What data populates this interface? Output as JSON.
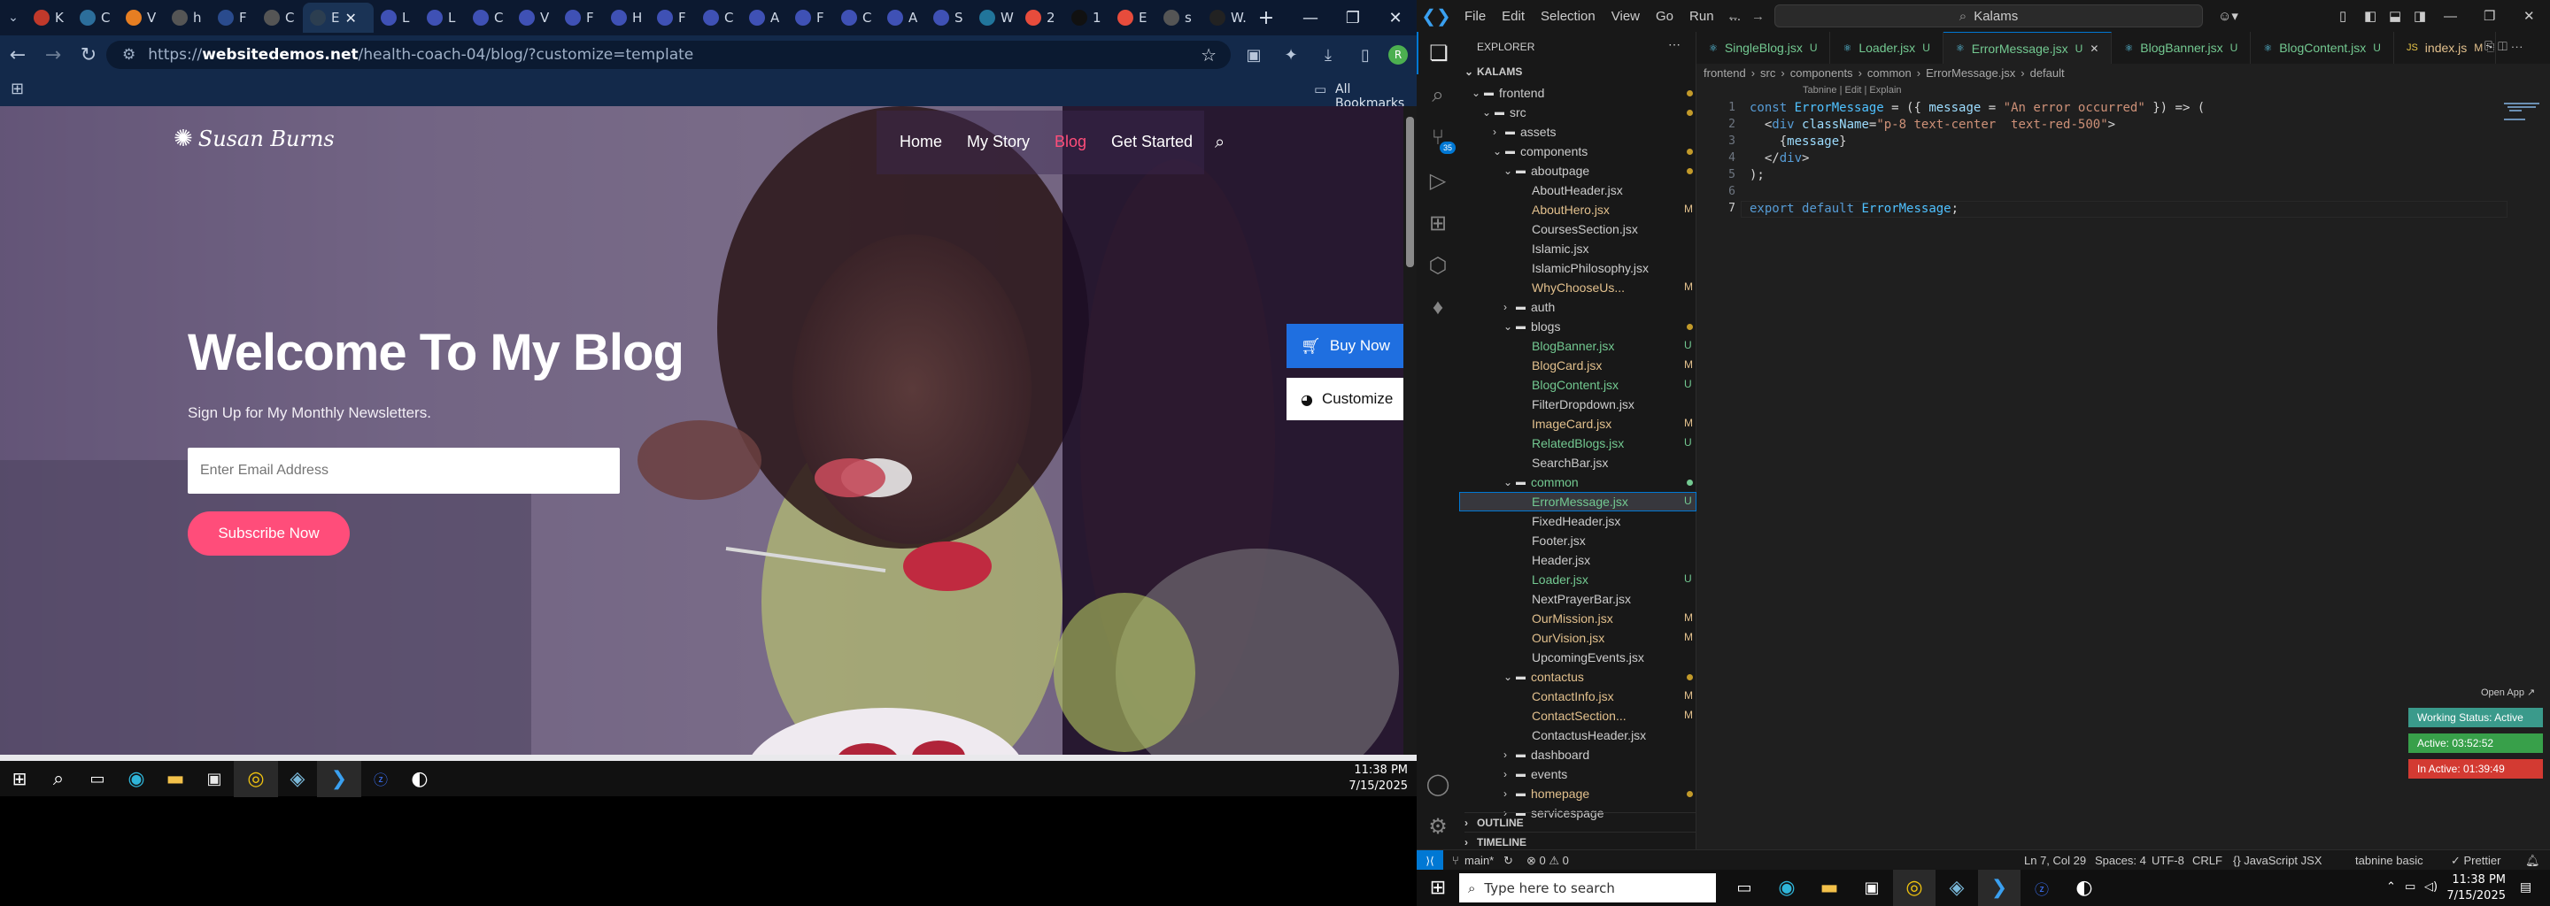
{
  "chrome": {
    "tabs": [
      {
        "label": "K",
        "color": "#c0392b"
      },
      {
        "label": "C",
        "color": "#2c6e9b"
      },
      {
        "label": "V",
        "color": "#e67e22"
      },
      {
        "label": "h",
        "color": "#555"
      },
      {
        "label": "F",
        "color": "#2a4b8d"
      },
      {
        "label": "C",
        "color": "#555"
      },
      {
        "label": "E",
        "color": "#2c3e50"
      },
      {
        "label": "L",
        "color": "#3f51b5"
      },
      {
        "label": "L",
        "color": "#3f51b5"
      },
      {
        "label": "C",
        "color": "#3f51b5"
      },
      {
        "label": "V",
        "color": "#3f51b5"
      },
      {
        "label": "F",
        "color": "#3f51b5"
      },
      {
        "label": "H",
        "color": "#3f51b5"
      },
      {
        "label": "F",
        "color": "#3f51b5"
      },
      {
        "label": "C",
        "color": "#3f51b5"
      },
      {
        "label": "A",
        "color": "#3f51b5"
      },
      {
        "label": "F",
        "color": "#3f51b5"
      },
      {
        "label": "C",
        "color": "#3f51b5"
      },
      {
        "label": "A",
        "color": "#3f51b5"
      },
      {
        "label": "S",
        "color": "#3f51b5"
      },
      {
        "label": "W",
        "color": "#21759b"
      },
      {
        "label": "2",
        "color": "#e74c3c"
      },
      {
        "label": "1",
        "color": "#111"
      },
      {
        "label": "E",
        "color": "#e74c3c"
      },
      {
        "label": "s",
        "color": "#555"
      },
      {
        "label": "W.",
        "color": "#222"
      }
    ],
    "new_tab": "+",
    "window_controls": {
      "minimize": "—",
      "restore": "❐",
      "close": "✕"
    },
    "url": {
      "scheme": "https://",
      "host": "websitedemos.net",
      "path": "/health-coach-04/blog/?customize=template"
    },
    "bookmarks_label": "All Bookmarks",
    "profile_initial": "R"
  },
  "site": {
    "logo": "Susan Burns",
    "nav": [
      "Home",
      "My Story",
      "Blog",
      "Get Started"
    ],
    "hero_title": "Welcome To My Blog",
    "hero_subtitle": "Sign Up for My Monthly Newsletters.",
    "email_placeholder": "Enter Email Address",
    "subscribe_label": "Subscribe Now",
    "buy_now_label": "Buy Now",
    "customize_label": "Customize",
    "accent": "#ff4d7a"
  },
  "left_taskbar": {
    "time": "11:38 PM",
    "date": "7/15/2025"
  },
  "vscode": {
    "menu": [
      "File",
      "Edit",
      "Selection",
      "View",
      "Go",
      "Run",
      "..."
    ],
    "search": "Kalams",
    "explorer_title": "EXPLORER",
    "workspace": "KALAMS",
    "tree": [
      {
        "label": "frontend",
        "depth": 0,
        "folder": true,
        "open": true,
        "color": "#cccccc",
        "dot": "#c29a2a"
      },
      {
        "label": "src",
        "depth": 1,
        "folder": true,
        "open": true,
        "color": "#cccccc",
        "dot": "#c29a2a"
      },
      {
        "label": "assets",
        "depth": 2,
        "folder": true,
        "open": false,
        "color": "#cccccc",
        "dot": ""
      },
      {
        "label": "components",
        "depth": 2,
        "folder": true,
        "open": true,
        "color": "#cccccc",
        "dot": "#c29a2a"
      },
      {
        "label": "aboutpage",
        "depth": 3,
        "folder": true,
        "open": true,
        "color": "#cccccc",
        "dot": "#c29a2a"
      },
      {
        "label": "AboutHeader.jsx",
        "depth": 4,
        "folder": false,
        "color": "#cccccc",
        "badge": ""
      },
      {
        "label": "AboutHero.jsx",
        "depth": 4,
        "folder": false,
        "color": "#e2c08d",
        "badge": "M"
      },
      {
        "label": "CoursesSection.jsx",
        "depth": 4,
        "folder": false,
        "color": "#cccccc",
        "badge": ""
      },
      {
        "label": "Islamic.jsx",
        "depth": 4,
        "folder": false,
        "color": "#cccccc",
        "badge": ""
      },
      {
        "label": "IslamicPhilosophy.jsx",
        "depth": 4,
        "folder": false,
        "color": "#cccccc",
        "badge": ""
      },
      {
        "label": "WhyChooseUs...",
        "depth": 4,
        "folder": false,
        "color": "#e2c08d",
        "badge": "M"
      },
      {
        "label": "auth",
        "depth": 3,
        "folder": true,
        "open": false,
        "color": "#cccccc",
        "dot": ""
      },
      {
        "label": "blogs",
        "depth": 3,
        "folder": true,
        "open": true,
        "color": "#cccccc",
        "dot": "#c29a2a"
      },
      {
        "label": "BlogBanner.jsx",
        "depth": 4,
        "folder": false,
        "color": "#73c991",
        "badge": "U"
      },
      {
        "label": "BlogCard.jsx",
        "depth": 4,
        "folder": false,
        "color": "#e2c08d",
        "badge": "M"
      },
      {
        "label": "BlogContent.jsx",
        "depth": 4,
        "folder": false,
        "color": "#73c991",
        "badge": "U"
      },
      {
        "label": "FilterDropdown.jsx",
        "depth": 4,
        "folder": false,
        "color": "#cccccc",
        "badge": ""
      },
      {
        "label": "ImageCard.jsx",
        "depth": 4,
        "folder": false,
        "color": "#e2c08d",
        "badge": "M"
      },
      {
        "label": "RelatedBlogs.jsx",
        "depth": 4,
        "folder": false,
        "color": "#73c991",
        "badge": "U"
      },
      {
        "label": "SearchBar.jsx",
        "depth": 4,
        "folder": false,
        "color": "#cccccc",
        "badge": ""
      },
      {
        "label": "common",
        "depth": 3,
        "folder": true,
        "open": true,
        "color": "#73c991",
        "dot": "#73c991"
      },
      {
        "label": "ErrorMessage.jsx",
        "depth": 4,
        "folder": false,
        "color": "#73c991",
        "badge": "U",
        "selected": true
      },
      {
        "label": "FixedHeader.jsx",
        "depth": 4,
        "folder": false,
        "color": "#cccccc",
        "badge": ""
      },
      {
        "label": "Footer.jsx",
        "depth": 4,
        "folder": false,
        "color": "#cccccc",
        "badge": ""
      },
      {
        "label": "Header.jsx",
        "depth": 4,
        "folder": false,
        "color": "#cccccc",
        "badge": ""
      },
      {
        "label": "Loader.jsx",
        "depth": 4,
        "folder": false,
        "color": "#73c991",
        "badge": "U"
      },
      {
        "label": "NextPrayerBar.jsx",
        "depth": 4,
        "folder": false,
        "color": "#cccccc",
        "badge": ""
      },
      {
        "label": "OurMission.jsx",
        "depth": 4,
        "folder": false,
        "color": "#e2c08d",
        "badge": "M"
      },
      {
        "label": "OurVision.jsx",
        "depth": 4,
        "folder": false,
        "color": "#e2c08d",
        "badge": "M"
      },
      {
        "label": "UpcomingEvents.jsx",
        "depth": 4,
        "folder": false,
        "color": "#cccccc",
        "badge": ""
      },
      {
        "label": "contactus",
        "depth": 3,
        "folder": true,
        "open": true,
        "color": "#e2c08d",
        "dot": "#c29a2a"
      },
      {
        "label": "ContactInfo.jsx",
        "depth": 4,
        "folder": false,
        "color": "#e2c08d",
        "badge": "M"
      },
      {
        "label": "ContactSection...",
        "depth": 4,
        "folder": false,
        "color": "#e2c08d",
        "badge": "M"
      },
      {
        "label": "ContactusHeader.jsx",
        "depth": 4,
        "folder": false,
        "color": "#cccccc",
        "badge": ""
      },
      {
        "label": "dashboard",
        "depth": 3,
        "folder": true,
        "open": false,
        "color": "#cccccc",
        "dot": ""
      },
      {
        "label": "events",
        "depth": 3,
        "folder": true,
        "open": false,
        "color": "#cccccc",
        "dot": ""
      },
      {
        "label": "homepage",
        "depth": 3,
        "folder": true,
        "open": false,
        "color": "#e2c08d",
        "dot": "#c29a2a"
      },
      {
        "label": "servicespage",
        "depth": 3,
        "folder": true,
        "open": false,
        "color": "#cccccc",
        "dot": ""
      }
    ],
    "outline_label": "OUTLINE",
    "timeline_label": "TIMELINE",
    "editor_tabs": [
      {
        "name": "SingleBlog.jsx",
        "status": "U",
        "active": false
      },
      {
        "name": "Loader.jsx",
        "status": "U",
        "active": false
      },
      {
        "name": "ErrorMessage.jsx",
        "status": "U",
        "active": true
      },
      {
        "name": "BlogBanner.jsx",
        "status": "U",
        "active": false
      },
      {
        "name": "BlogContent.jsx",
        "status": "U",
        "active": false
      },
      {
        "name": "index.js",
        "status": "M",
        "active": false
      }
    ],
    "breadcrumb": [
      "frontend",
      "src",
      "components",
      "common",
      "ErrorMessage.jsx",
      "default"
    ],
    "codelens": "Tabnine | Edit | Explain",
    "code_lines": [
      "const ErrorMessage = ({ message = \"An error occurred\" }) => (",
      "  <div className=\"p-8 text-center  text-red-500\">",
      "    {message}",
      "  </div>",
      ");",
      "",
      "export default ErrorMessage;"
    ],
    "open_app": "Open App ↗",
    "working_status": "Working Status: Active",
    "active_time": "Active: 03:52:52",
    "inactive_time": "In Active: 01:39:49",
    "status_bar": {
      "branch": "main*",
      "problems": "⊗ 0 ⚠ 0",
      "position": "Ln 7, Col 29",
      "spaces": "Spaces: 4",
      "encoding": "UTF-8",
      "eol": "CRLF",
      "language": "{} JavaScript JSX",
      "tabnine": "tabnine basic",
      "prettier": "✓ Prettier"
    }
  },
  "right_taskbar": {
    "search_placeholder": "Type here to search",
    "time": "11:38 PM",
    "date": "7/15/2025"
  }
}
